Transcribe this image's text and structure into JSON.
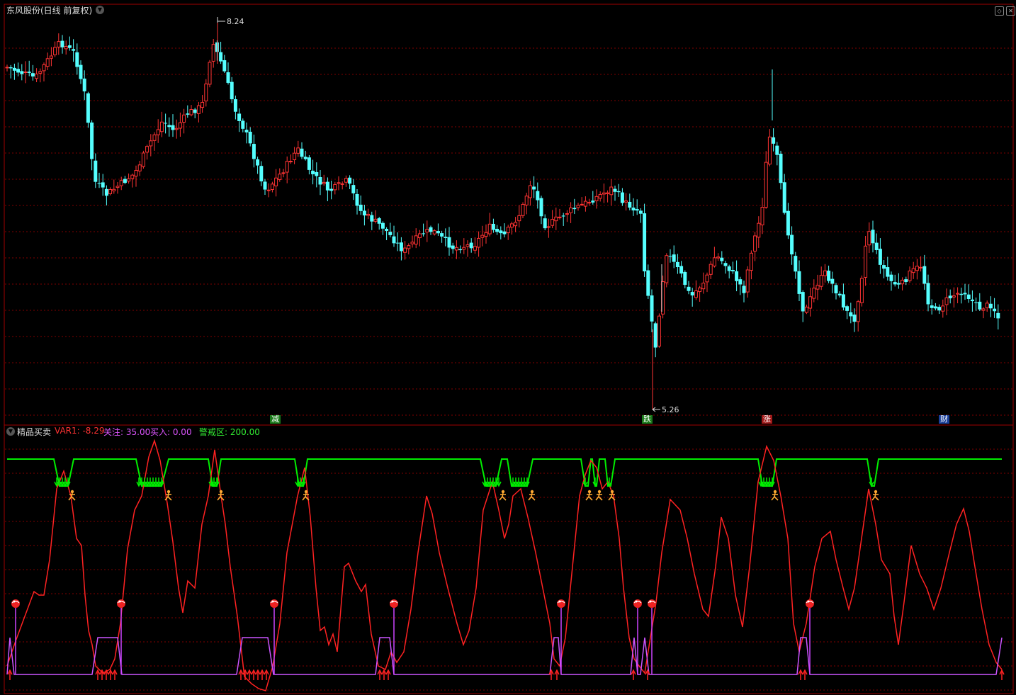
{
  "main_panel": {
    "title": "东风股份(日线 前复权)",
    "max_label": "8.24",
    "min_label": "5.26",
    "event_markers": [
      {
        "label": "减",
        "bg": "#1a7a1a",
        "fg": "#ffffff"
      },
      {
        "label": "跌",
        "bg": "#1a7a1a",
        "fg": "#ffffff"
      },
      {
        "label": "涨",
        "bg": "#a01818",
        "fg": "#ffffff"
      },
      {
        "label": "财",
        "bg": "#1a3f9a",
        "fg": "#ffffff"
      }
    ]
  },
  "indicator_panel": {
    "name": "精品买卖",
    "var1": "VAR1: -8.29",
    "guanzhu": "关注: 35.00",
    "mairu": "买入: 0.00",
    "jingjie": "警戒区: 200.00"
  },
  "colors": {
    "up": "#ff3333",
    "down": "#55ffff",
    "grid": "#800000",
    "warning_line": "#00ee00",
    "var1_line": "#ff2222",
    "buy_line": "#cc55ff"
  },
  "icons": {
    "collapse": "chevron-down-icon",
    "window_controls": [
      "restore-icon",
      "close-icon"
    ],
    "signals": [
      "sell-arrow-icon",
      "runner-icon",
      "ball-icon",
      "buy-arrow-icon"
    ]
  }
}
